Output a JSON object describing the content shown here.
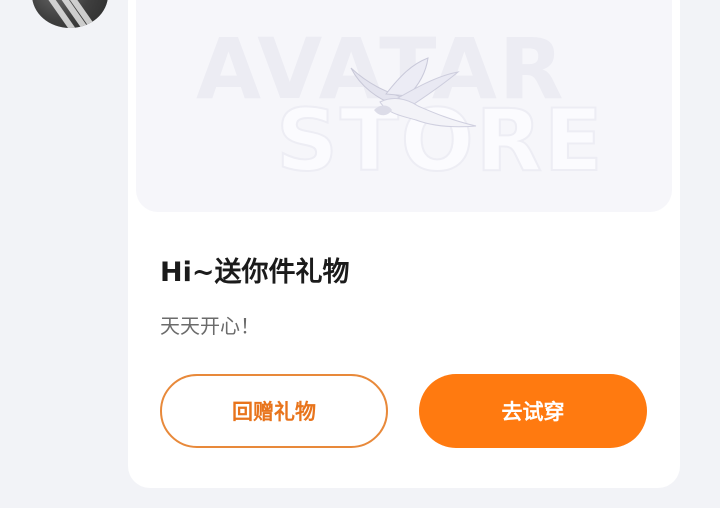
{
  "banner": {
    "line1": "AVATAR",
    "line2": "STORE"
  },
  "gift_card": {
    "title": "Hi~送你件礼物",
    "message": "天天开心！",
    "return_gift_button": "回赠礼物",
    "try_on_button": "去试穿"
  },
  "colors": {
    "page_background": "#f2f3f7",
    "card_background": "#ffffff",
    "accent_orange": "#ff7a10",
    "outline_orange": "#e8893a",
    "title_text": "#1b1b1b",
    "message_text": "#6b6b6b"
  }
}
